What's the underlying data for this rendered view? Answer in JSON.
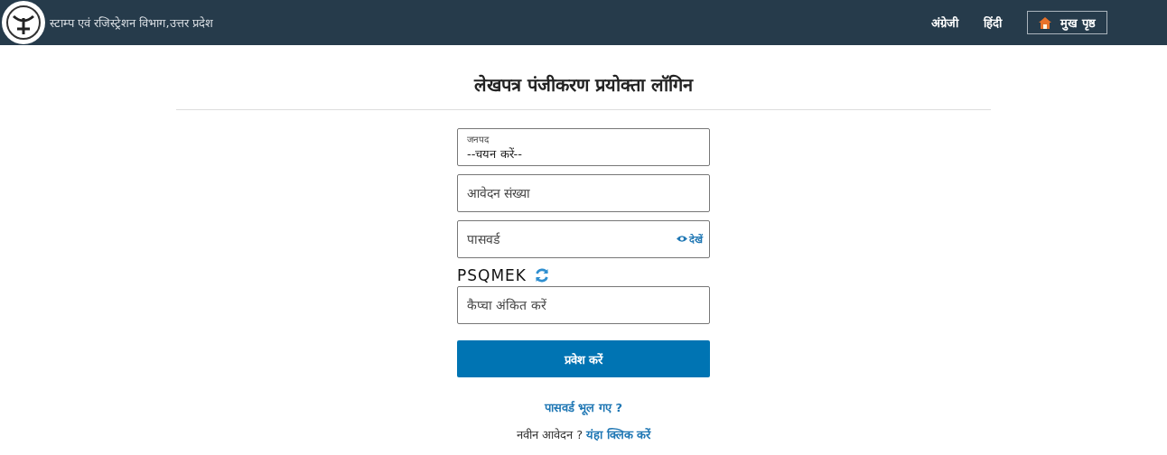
{
  "header": {
    "title": "स्टाम्प एवं रजिस्ट्रेशन विभाग,उत्तर प्रदेश",
    "nav": [
      {
        "label": "अंग्रेजी",
        "kind": "link"
      },
      {
        "label": "हिंदी",
        "kind": "link"
      },
      {
        "label": "मुख पृष्ठ",
        "kind": "home"
      }
    ]
  },
  "heading": "लेखपत्र पंजीकरण प्रयोक्ता लॉगिन",
  "form": {
    "district": {
      "label": "जनपद",
      "value": "--चयन करें--"
    },
    "application_number": {
      "placeholder": "आवेदन संख्या"
    },
    "password": {
      "placeholder": "पासवर्ड",
      "show_label": "देखें"
    },
    "captcha_text": "PSQMEK",
    "captcha": {
      "placeholder": "कैप्चा अंकित करें"
    },
    "submit": "प्रवेश करें"
  },
  "forgot_link": "पासवर्ड भूल गए ?",
  "new_application": {
    "text": "नवीन आवेदन ?",
    "link": "यंहा क्लिक करें"
  }
}
